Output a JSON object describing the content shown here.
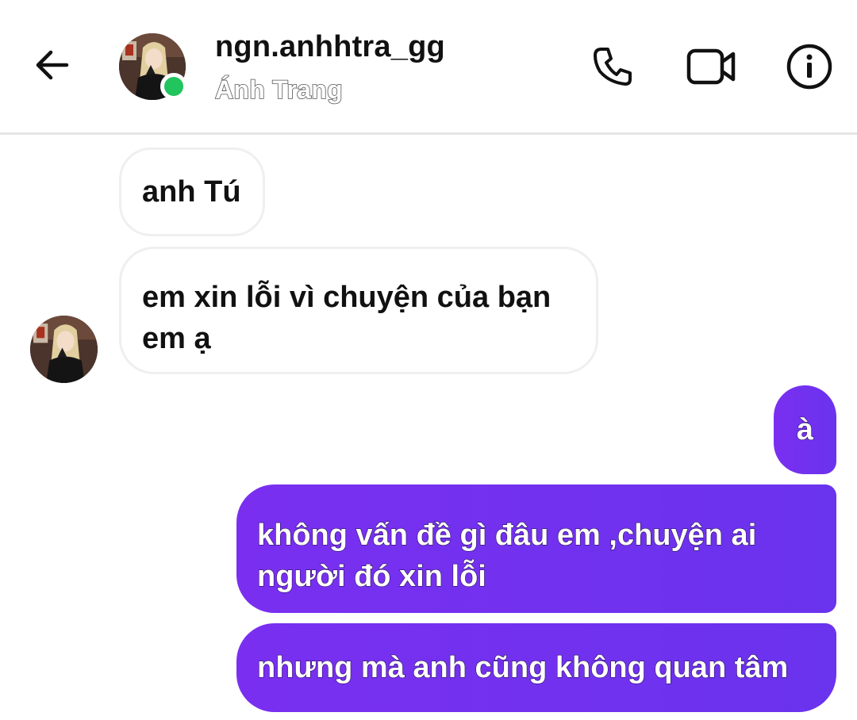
{
  "header": {
    "username": "ngn.anhhtra_gg",
    "display_name": "Ánh Trang",
    "online": true,
    "icons": {
      "back": "arrow-left-icon",
      "call": "phone-icon",
      "video": "video-camera-icon",
      "info": "info-icon"
    }
  },
  "messages": [
    {
      "sender": "them",
      "text": "anh Tú"
    },
    {
      "sender": "them",
      "text_lines": [
        "em xin lỗi vì chuyện của bạn",
        "em ạ"
      ]
    },
    {
      "sender": "me",
      "text": "à"
    },
    {
      "sender": "me",
      "text_lines": [
        "không vấn đề gì đâu em ,chuyện ai",
        "người đó xin lỗi"
      ]
    },
    {
      "sender": "me",
      "text": "nhưng mà anh cũng không quan tâm"
    }
  ],
  "colors": {
    "outgoing_bubble": "#7130ef",
    "online_dot": "#21c45d",
    "incoming_border": "#efefef"
  }
}
